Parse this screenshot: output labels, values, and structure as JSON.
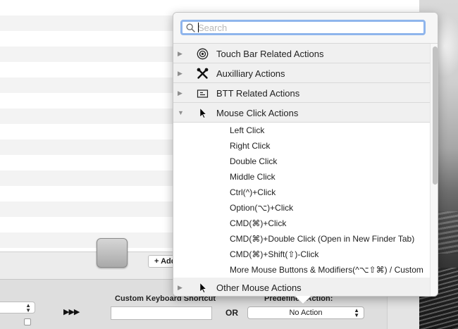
{
  "background": {
    "add_button_label": "+ Add",
    "shortcut_label": "Custom Keyboard Shortcut",
    "or_label": "OR",
    "predefined_label": "Predefined Action:",
    "predefined_value": "No Action",
    "play_arrows": "▶▶▶"
  },
  "popover": {
    "search": {
      "placeholder": "Search",
      "value": ""
    },
    "categories": [
      {
        "label": "Touch Bar Related Actions",
        "icon": "touch-bar-icon",
        "expanded": false
      },
      {
        "label": "Auxilliary Actions",
        "icon": "tools-icon",
        "expanded": false
      },
      {
        "label": "BTT Related Actions",
        "icon": "btt-icon",
        "expanded": false
      },
      {
        "label": "Mouse Click Actions",
        "icon": "cursor-icon",
        "expanded": true
      },
      {
        "label": "Other Mouse Actions",
        "icon": "cursor-icon",
        "expanded": false
      }
    ],
    "mouse_click_items": [
      "Left Click",
      "Right Click",
      "Double Click",
      "Middle Click",
      "Ctrl(^)+Click",
      "Option(⌥)+Click",
      "CMD(⌘)+Click",
      "CMD(⌘)+Double Click (Open in New Finder Tab)",
      "CMD(⌘)+Shift(⇧)-Click",
      "More Mouse Buttons & Modifiers(^⌥⇧⌘) / Custom"
    ],
    "disclosure_collapsed": "▶",
    "disclosure_expanded": "▼"
  },
  "colors": {
    "focus_ring": "#8fb5ec",
    "category_bg": "#f0f0f0"
  }
}
